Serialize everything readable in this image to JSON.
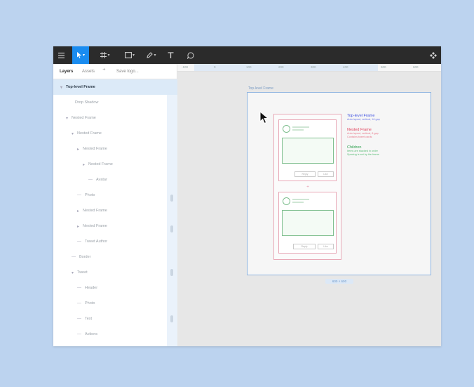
{
  "toolbar": {
    "items": [
      {
        "name": "menu",
        "icon": "hamburger-icon",
        "has_caret": false
      },
      {
        "name": "move",
        "icon": "pointer-icon",
        "has_caret": true,
        "active": true
      },
      {
        "name": "frame",
        "icon": "frame-icon",
        "has_caret": true
      },
      {
        "name": "shape",
        "icon": "rectangle-icon",
        "has_caret": true
      },
      {
        "name": "pen",
        "icon": "pen-icon",
        "has_caret": true
      },
      {
        "name": "text",
        "icon": "text-icon",
        "has_caret": false
      },
      {
        "name": "comment",
        "icon": "comment-icon",
        "has_caret": false
      }
    ],
    "right_icon": "component-icon",
    "accent": "#1a8cf0",
    "background": "#2b2b2b"
  },
  "sidebar": {
    "tabs": {
      "layers": "Layers",
      "assets": "Assets",
      "page": "Save logo..."
    },
    "layers": [
      {
        "label": "Top-level Frame",
        "indent": 0,
        "selected": true,
        "chevron": "▾"
      },
      {
        "label": "Drop Shadow",
        "indent": 2,
        "chevron": ""
      },
      {
        "label": "Nested Frame",
        "indent": 1,
        "chevron": "▾"
      },
      {
        "label": "Nested Frame",
        "indent": 2,
        "chevron": "▾"
      },
      {
        "label": "Nested Frame",
        "indent": 3,
        "chevron": "▸"
      },
      {
        "label": "Nested Frame",
        "indent": 4,
        "chevron": "▸"
      },
      {
        "label": "Avatar",
        "indent": 5,
        "chevron": "—"
      },
      {
        "label": "Photo",
        "indent": 3,
        "chevron": "—"
      },
      {
        "label": "Nested Frame",
        "indent": 3,
        "chevron": "▸"
      },
      {
        "label": "Nested Frame",
        "indent": 3,
        "chevron": "▸"
      },
      {
        "label": "Tweet Author",
        "indent": 3,
        "chevron": "—"
      },
      {
        "label": "Border",
        "indent": 2,
        "chevron": "—"
      },
      {
        "label": "Tweet",
        "indent": 2,
        "chevron": "▾"
      },
      {
        "label": "Header",
        "indent": 3,
        "chevron": "—"
      },
      {
        "label": "Photo",
        "indent": 3,
        "chevron": "—"
      },
      {
        "label": "Text",
        "indent": 3,
        "chevron": "—"
      },
      {
        "label": "Actions",
        "indent": 3,
        "chevron": "—"
      }
    ]
  },
  "canvas": {
    "ruler_ticks": [
      "-100",
      "0",
      "100",
      "200",
      "300",
      "400",
      "500",
      "600"
    ],
    "frame_label": "Top-level Frame",
    "dimensions": "600 × 600",
    "notes": [
      {
        "title": "Top-level Frame",
        "text": [
          "Auto layout, vertical, 16 gap"
        ],
        "color": "#3d4fe0"
      },
      {
        "title": "Nested Frame",
        "text": [
          "Auto layout, vertical, 8 gap",
          "Contains tweet cards"
        ],
        "color": "#e0405a"
      },
      {
        "title": "Children",
        "text": [
          "Items are stacked in order",
          "Spacing is set by the frame"
        ],
        "color": "#2ea04e"
      }
    ],
    "card_buttons": [
      "Reply",
      "Like"
    ],
    "colors": {
      "frame_border": "#8fb4e0",
      "artboard_border": "#e8a9b7",
      "content_border": "#7fbf8f"
    }
  }
}
